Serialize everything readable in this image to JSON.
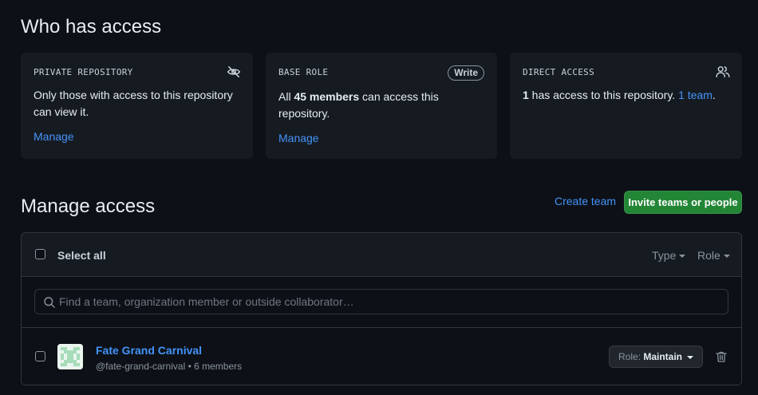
{
  "who_has_access": {
    "title": "Who has access",
    "private_repo": {
      "label": "PRIVATE REPOSITORY",
      "icon": "eye-closed-icon",
      "text": "Only those with access to this repository can view it.",
      "link": "Manage"
    },
    "base_role": {
      "label": "BASE ROLE",
      "badge": "Write",
      "text_prefix": "All ",
      "text_bold": "45 members",
      "text_suffix": " can access this repository.",
      "link": "Manage"
    },
    "direct_access": {
      "label": "DIRECT ACCESS",
      "icon": "people-icon",
      "count": "1",
      "text_middle": " has access to this repository. ",
      "team_link": "1 team",
      "text_end": "."
    }
  },
  "manage_access": {
    "title": "Manage access",
    "create_team": "Create team",
    "invite_button": "Invite teams or people",
    "select_all": "Select all",
    "filter_type": "Type",
    "filter_role": "Role",
    "search_placeholder": "Find a team, organization member or outside collaborator…",
    "members": [
      {
        "name": "Fate Grand Carnival",
        "handle": "@fate-grand-carnival",
        "separator": " • ",
        "members": "6 members",
        "role_label": "Role: ",
        "role_value": "Maintain"
      }
    ]
  },
  "colors": {
    "background": "#0d1117",
    "card": "#161b22",
    "link": "#4493f8",
    "primary_button": "#238636",
    "border": "#30363d"
  }
}
